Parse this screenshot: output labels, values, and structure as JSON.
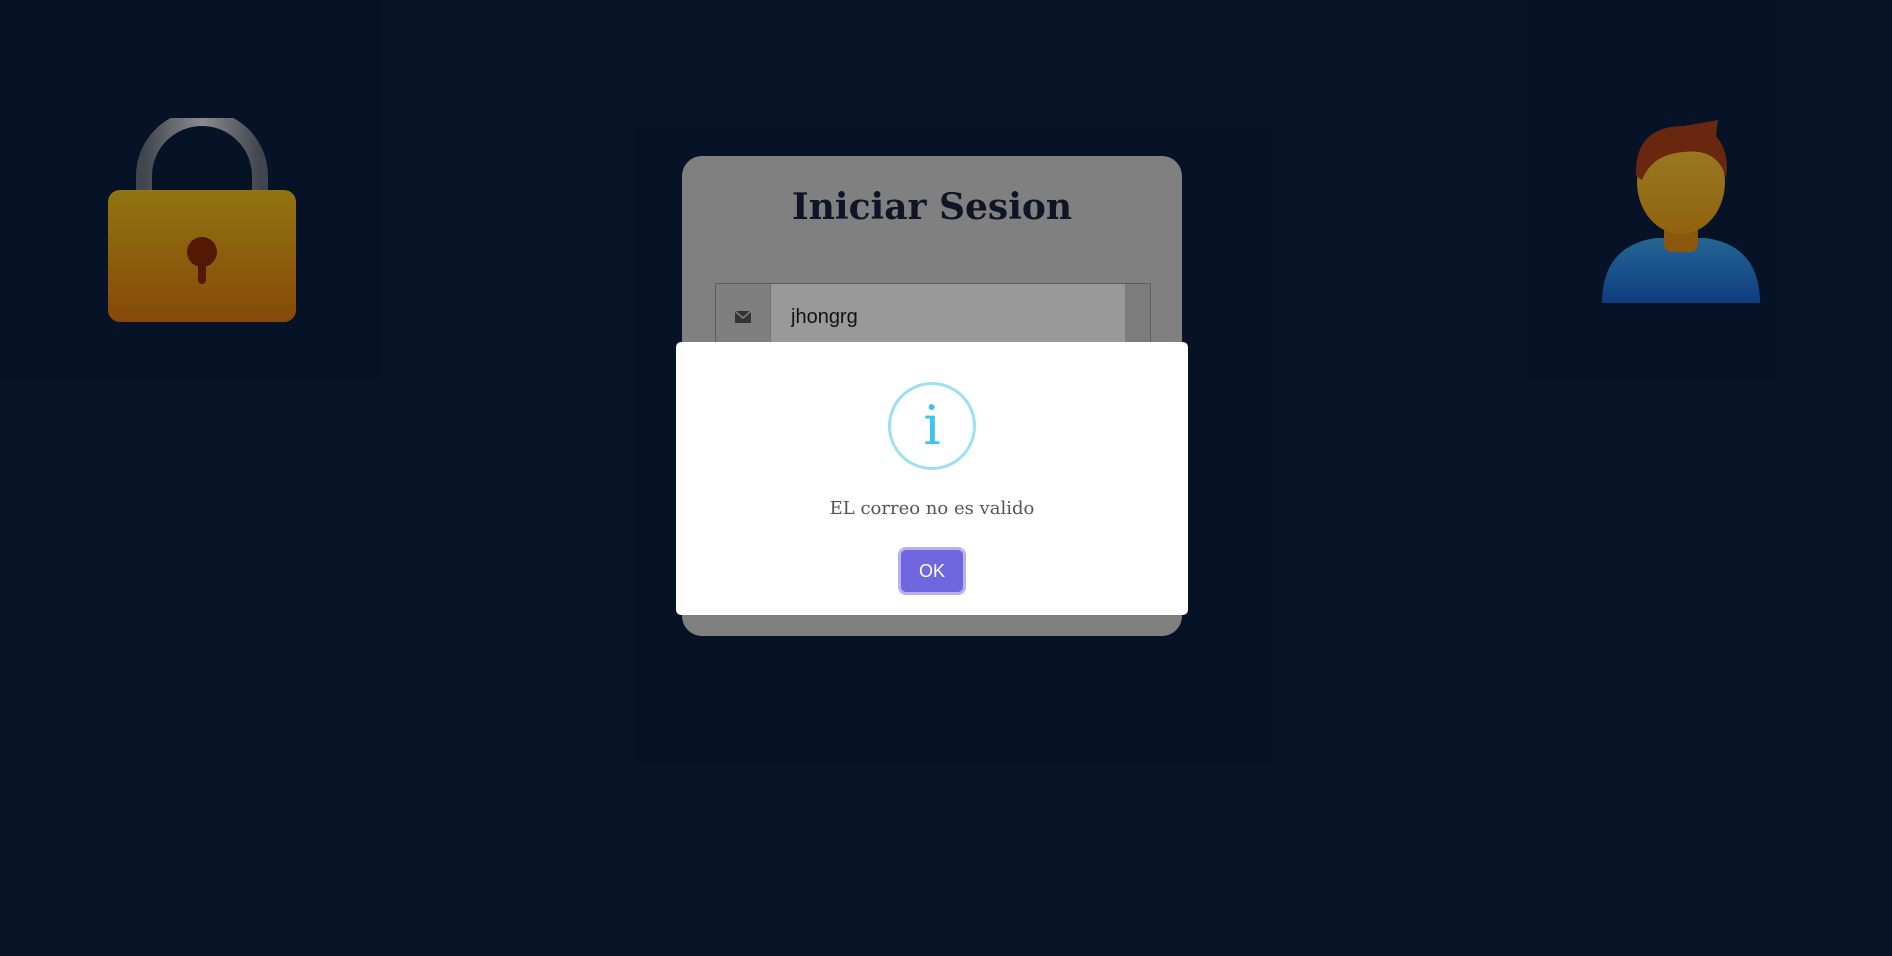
{
  "login": {
    "title": "Iniciar Sesion",
    "email_value": "jhongrg",
    "email_icon": "envelope-icon"
  },
  "decor": {
    "left_icon": "lock-icon",
    "right_icon": "user-avatar-icon"
  },
  "alert": {
    "icon": "info-icon",
    "icon_glyph": "i",
    "message": "EL correo no es valido",
    "ok_label": "OK"
  },
  "colors": {
    "background": "#0b1f3f",
    "card": "#d6d6d6",
    "title": "#1a2340",
    "info_accent": "#3fc3ee",
    "button": "#7066e0"
  }
}
